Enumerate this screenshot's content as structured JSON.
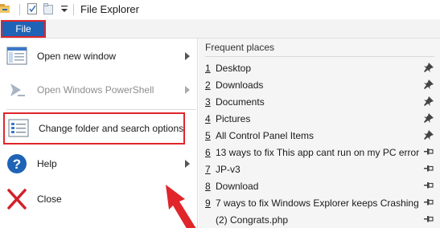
{
  "window": {
    "title": "File Explorer"
  },
  "quick_access": {
    "icons": [
      "folder-icon",
      "properties-icon",
      "new-folder-icon",
      "customize-dropdown-icon"
    ]
  },
  "ribbon": {
    "file_tab": "File"
  },
  "menu": {
    "items": [
      {
        "label": "Open new window",
        "icon": "new-window-icon",
        "submenu": true,
        "enabled": true
      },
      {
        "label": "Open Windows PowerShell",
        "icon": "powershell-icon",
        "submenu": true,
        "enabled": false
      },
      {
        "label": "Change folder and search options",
        "icon": "folder-options-icon",
        "submenu": false,
        "enabled": true,
        "highlighted": true
      },
      {
        "label": "Help",
        "icon": "help-icon",
        "submenu": true,
        "enabled": true
      },
      {
        "label": "Close",
        "icon": "close-icon",
        "submenu": false,
        "enabled": true
      }
    ]
  },
  "frequent_places": {
    "title": "Frequent places",
    "items": [
      {
        "num": "1",
        "name": "Desktop",
        "pinned": true
      },
      {
        "num": "2",
        "name": "Downloads",
        "pinned": true
      },
      {
        "num": "3",
        "name": "Documents",
        "pinned": true
      },
      {
        "num": "4",
        "name": "Pictures",
        "pinned": true
      },
      {
        "num": "5",
        "name": "All Control Panel Items",
        "pinned": true
      },
      {
        "num": "6",
        "name": "13 ways to fix This app cant run on my PC error",
        "pinned": false
      },
      {
        "num": "7",
        "name": "JP-v3",
        "pinned": false
      },
      {
        "num": "8",
        "name": "Download",
        "pinned": false
      },
      {
        "num": "9",
        "name": "7 ways to fix Windows Explorer keeps Crashing",
        "pinned": false
      },
      {
        "num": "",
        "name": "(2) Congrats.php",
        "pinned": false
      }
    ]
  },
  "colors": {
    "file_tab_bg": "#1f63b6",
    "highlight_border": "#e0252b",
    "annotation_arrow": "#e0252b"
  }
}
